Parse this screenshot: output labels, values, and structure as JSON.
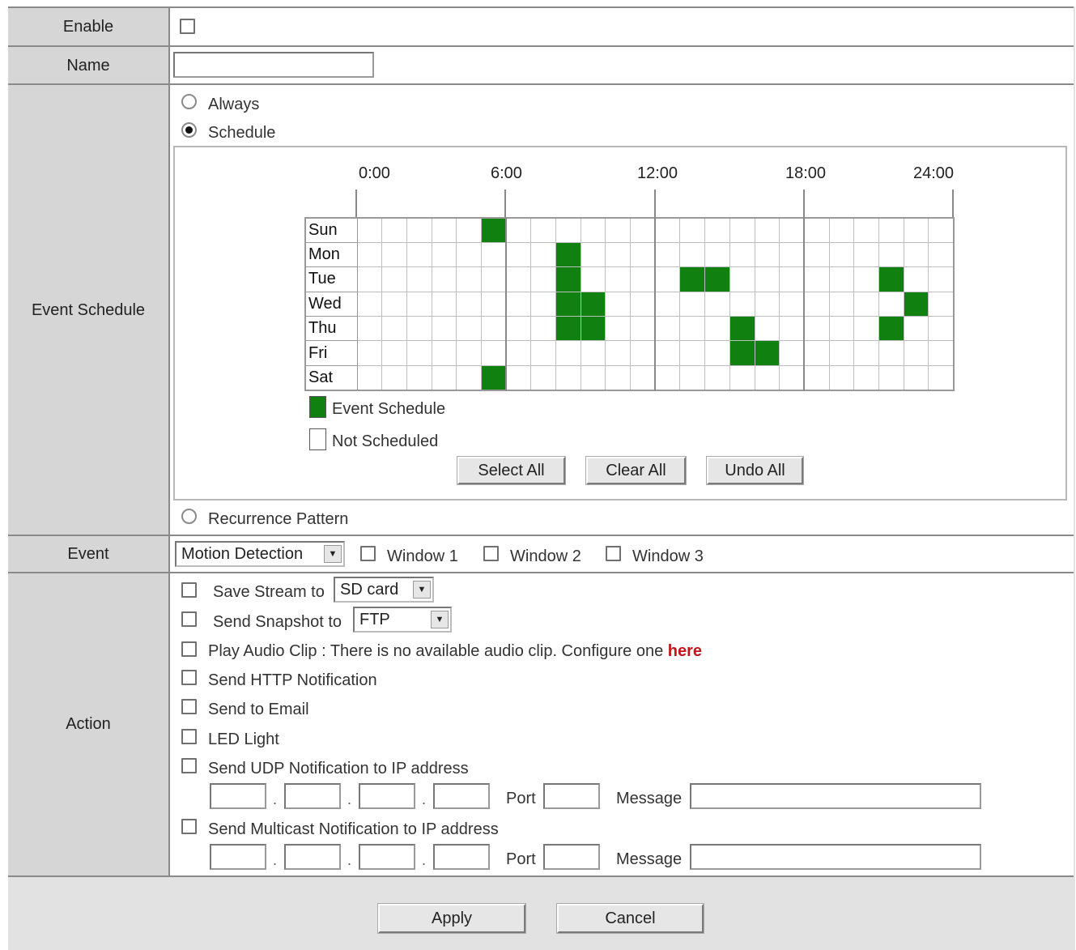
{
  "form": {
    "enable_label": "Enable",
    "name_label": "Name",
    "name_value": "",
    "event_schedule_label": "Event Schedule",
    "event_label": "Event",
    "action_label": "Action"
  },
  "schedule": {
    "always_label": "Always",
    "schedule_label": "Schedule",
    "recurrence_label": "Recurrence Pattern",
    "selected_mode": "Schedule",
    "time_labels": [
      "0:00",
      "6:00",
      "12:00",
      "18:00",
      "24:00"
    ],
    "days": [
      "Sun",
      "Mon",
      "Tue",
      "Wed",
      "Thu",
      "Fri",
      "Sat"
    ],
    "slot_count": 24,
    "active_slots": {
      "Sun": [
        5
      ],
      "Mon": [
        8
      ],
      "Tue": [
        8,
        13,
        14,
        21
      ],
      "Wed": [
        8,
        9,
        22
      ],
      "Thu": [
        8,
        9,
        15,
        21
      ],
      "Fri": [
        15,
        16
      ],
      "Sat": [
        5
      ]
    },
    "active_color": "#108010",
    "legend_scheduled": "Event Schedule",
    "legend_not_scheduled": "Not Scheduled",
    "select_all": "Select All",
    "clear_all": "Clear All",
    "undo_all": "Undo All"
  },
  "event": {
    "type_value": "Motion Detection",
    "window1": "Window 1",
    "window2": "Window 2",
    "window3": "Window 3"
  },
  "action": {
    "save_stream_label": "Save Stream to",
    "save_stream_value": "SD card",
    "send_snapshot_label": "Send Snapshot to",
    "send_snapshot_value": "FTP",
    "play_audio_text": "Play Audio Clip : There is no available audio clip. Configure one",
    "play_audio_link": "here",
    "http_notification": "Send HTTP Notification",
    "send_email": "Send to Email",
    "led_light": "LED Light",
    "udp_label": "Send UDP Notification to IP address",
    "multicast_label": "Send Multicast Notification to IP address",
    "port_label": "Port",
    "message_label": "Message",
    "ip_separator": "."
  },
  "footer": {
    "apply": "Apply",
    "cancel": "Cancel"
  }
}
